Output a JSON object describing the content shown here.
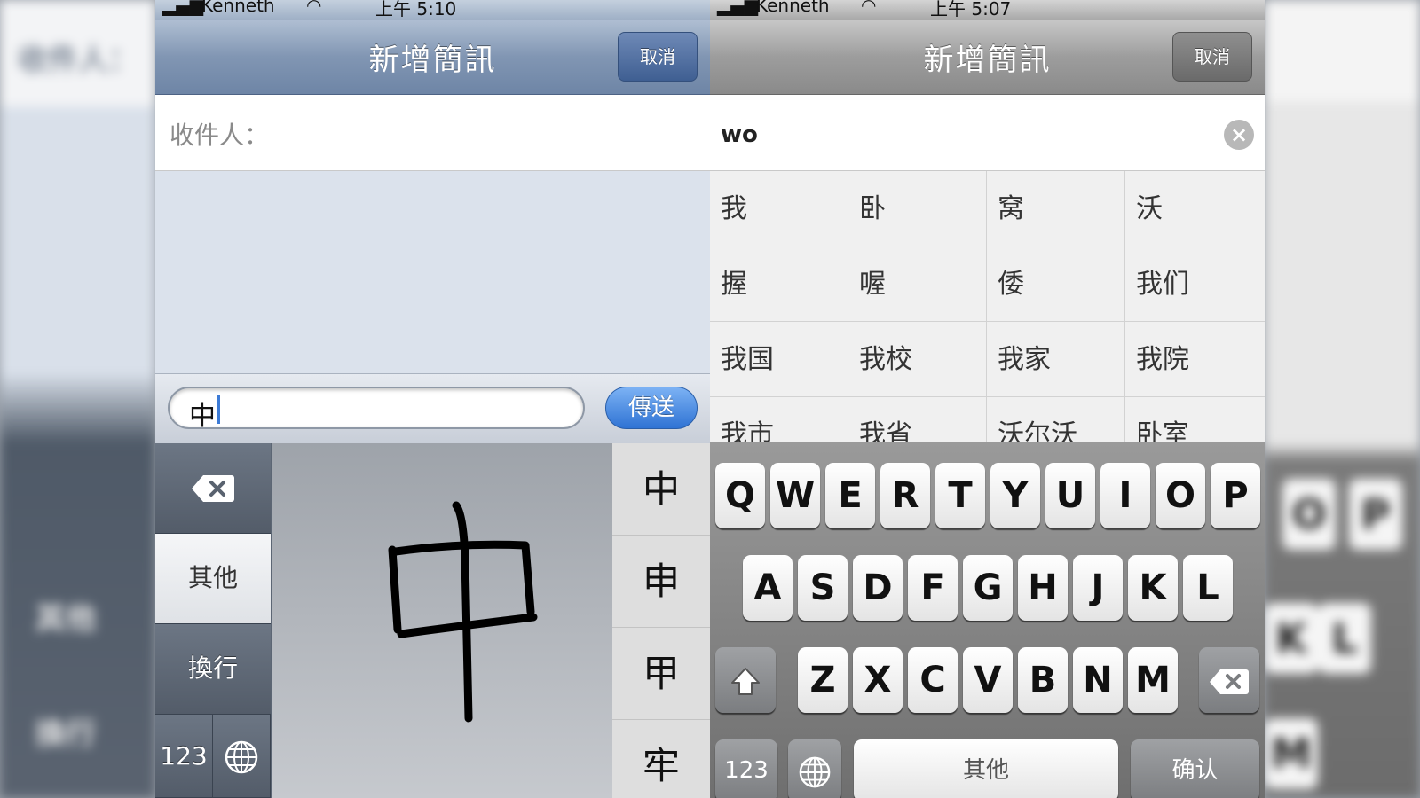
{
  "left": {
    "status": {
      "carrier": "Kenneth",
      "time": "上午 5:10"
    },
    "title": "新增簡訊",
    "cancel_label": "取消",
    "recipient_label": "收件人：",
    "compose_value": "中",
    "send_label": "傳送",
    "keys": {
      "other": "其他",
      "newline": "換行",
      "numbers": "123"
    },
    "candidates": [
      "中",
      "申",
      "甲",
      "牢"
    ]
  },
  "right": {
    "status": {
      "carrier": "Kenneth",
      "time": "上午 5:07"
    },
    "title": "新增簡訊",
    "cancel_label": "取消",
    "search_value": "wo",
    "candidates": [
      [
        "我",
        "卧",
        "窝",
        "沃"
      ],
      [
        "握",
        "喔",
        "倭",
        "我们"
      ],
      [
        "我国",
        "我校",
        "我家",
        "我院"
      ],
      [
        "我市",
        "我省",
        "沃尔沃",
        "卧室"
      ]
    ],
    "keyboard": {
      "row1": [
        "Q",
        "W",
        "E",
        "R",
        "T",
        "Y",
        "U",
        "I",
        "O",
        "P"
      ],
      "row2": [
        "A",
        "S",
        "D",
        "F",
        "G",
        "H",
        "J",
        "K",
        "L"
      ],
      "row3": [
        "Z",
        "X",
        "C",
        "V",
        "B",
        "N",
        "M"
      ],
      "numbers": "123",
      "other": "其他",
      "confirm": "确认"
    }
  },
  "background": {
    "left_text": "收件人：",
    "left_other": "其他",
    "left_newline": "換行",
    "right_keys": [
      "O",
      "P",
      "K",
      "L",
      "M"
    ]
  },
  "colors": {
    "send_blue": "#2f73d4",
    "nav_blue": "#6e85a6",
    "nav_gray": "#8a8a8a",
    "caret": "#3d7bd6"
  }
}
